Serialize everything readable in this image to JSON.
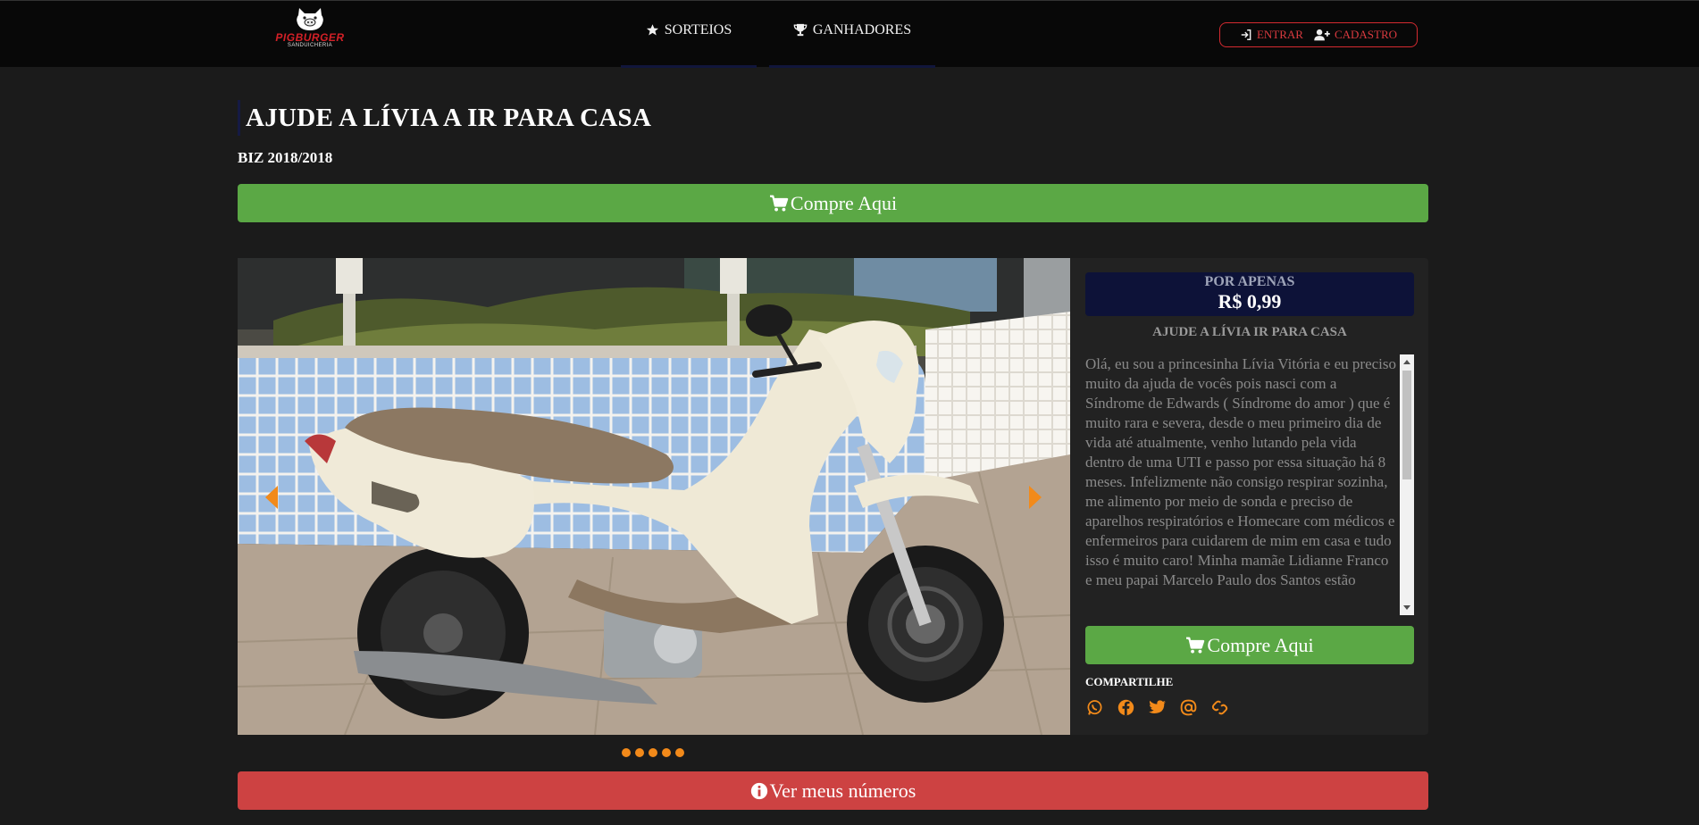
{
  "brand": {
    "name": "PIGBURGER",
    "tagline": "SANDUICHERIA"
  },
  "nav": {
    "items": [
      {
        "label": "SORTEIOS",
        "icon": "star-icon"
      },
      {
        "label": "GANHADORES",
        "icon": "trophy-icon"
      }
    ],
    "login_label": "ENTRAR",
    "signup_label": "CADASTRO"
  },
  "raffle": {
    "title": "AJUDE A LÍVIA A IR PARA CASA",
    "subtitle": "BIZ 2018/2018",
    "buy_label": "Compre Aqui",
    "price_label": "POR APENAS",
    "price_value": "R$ 0,99",
    "side_title": "AJUDE A LÍVIA IR PARA CASA",
    "description": "Olá, eu sou a princesinha Lívia Vitória e eu preciso muito da ajuda de vocês pois nasci com a Síndrome de Edwards ( Síndrome do amor ) que é muito rara e severa, desde o meu primeiro dia de vida até atualmente, venho lutando pela vida dentro de uma UTI e passo por essa situação há 8 meses. Infelizmente não consigo respirar sozinha, me alimento por meio de sonda e preciso de aparelhos respiratórios e Homecare com médicos e enfermeiros para cuidarem de mim em casa e tudo isso é muito caro! Minha mamãe Lidianne Franco e meu papai Marcelo Paulo dos Santos estão",
    "share_label": "COMPARTILHE",
    "my_numbers_label": "Ver meus números"
  },
  "carousel": {
    "slides": 5,
    "active": 1
  },
  "colors": {
    "background": "#1b1b1b",
    "navbar": "#080808",
    "green": "#5ba845",
    "red": "#cd4242",
    "navy": "#0d1238",
    "orange": "#f28a1a",
    "auth_red": "#d42a30"
  },
  "icons": {
    "cart": "cart-icon",
    "info": "info-icon",
    "share": [
      "whatsapp-icon",
      "facebook-icon",
      "twitter-icon",
      "at-sign-icon",
      "link-icon"
    ]
  }
}
